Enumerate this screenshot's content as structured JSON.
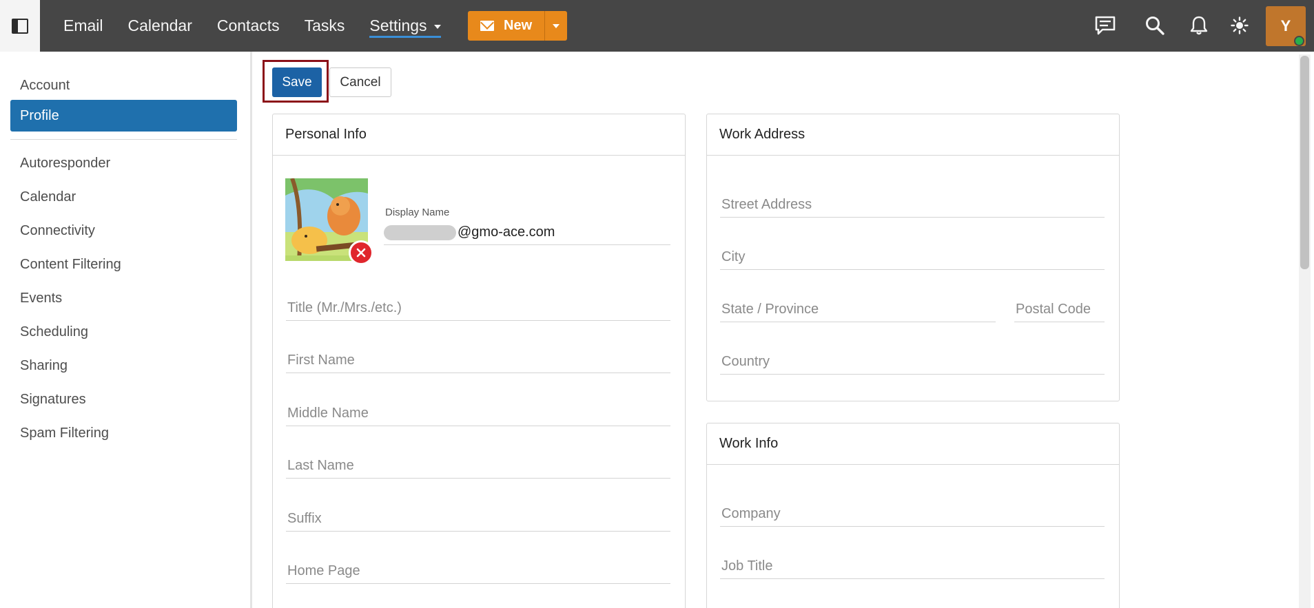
{
  "topbar": {
    "nav": [
      "Email",
      "Calendar",
      "Contacts",
      "Tasks"
    ],
    "settings_label": "Settings",
    "new_label": "New",
    "avatar_initial": "Y",
    "icons": [
      "chat-icon",
      "search-icon",
      "bell-icon",
      "brightness-icon"
    ]
  },
  "sidebar": {
    "top_items": [
      "Account",
      "Profile"
    ],
    "active_item": "Profile",
    "items": [
      "Autoresponder",
      "Calendar",
      "Connectivity",
      "Content Filtering",
      "Events",
      "Scheduling",
      "Sharing",
      "Signatures",
      "Spam Filtering"
    ]
  },
  "toolbar": {
    "save_label": "Save",
    "cancel_label": "Cancel"
  },
  "personal_info": {
    "title": "Personal Info",
    "display_name_label": "Display Name",
    "display_name_value": "@gmo-ace.com",
    "fields": [
      "Title (Mr./Mrs./etc.)",
      "First Name",
      "Middle Name",
      "Last Name",
      "Suffix",
      "Home Page"
    ]
  },
  "work_address": {
    "title": "Work Address",
    "street": "Street Address",
    "city": "City",
    "state": "State / Province",
    "postal": "Postal Code",
    "country": "Country"
  },
  "work_info": {
    "title": "Work Info",
    "company": "Company",
    "job_title": "Job Title"
  },
  "colors": {
    "topbar": "#464646",
    "accent": "#1f70ad",
    "new_button": "#e8891b",
    "save_outline": "#8b1018",
    "remove_badge": "#e0262d"
  }
}
